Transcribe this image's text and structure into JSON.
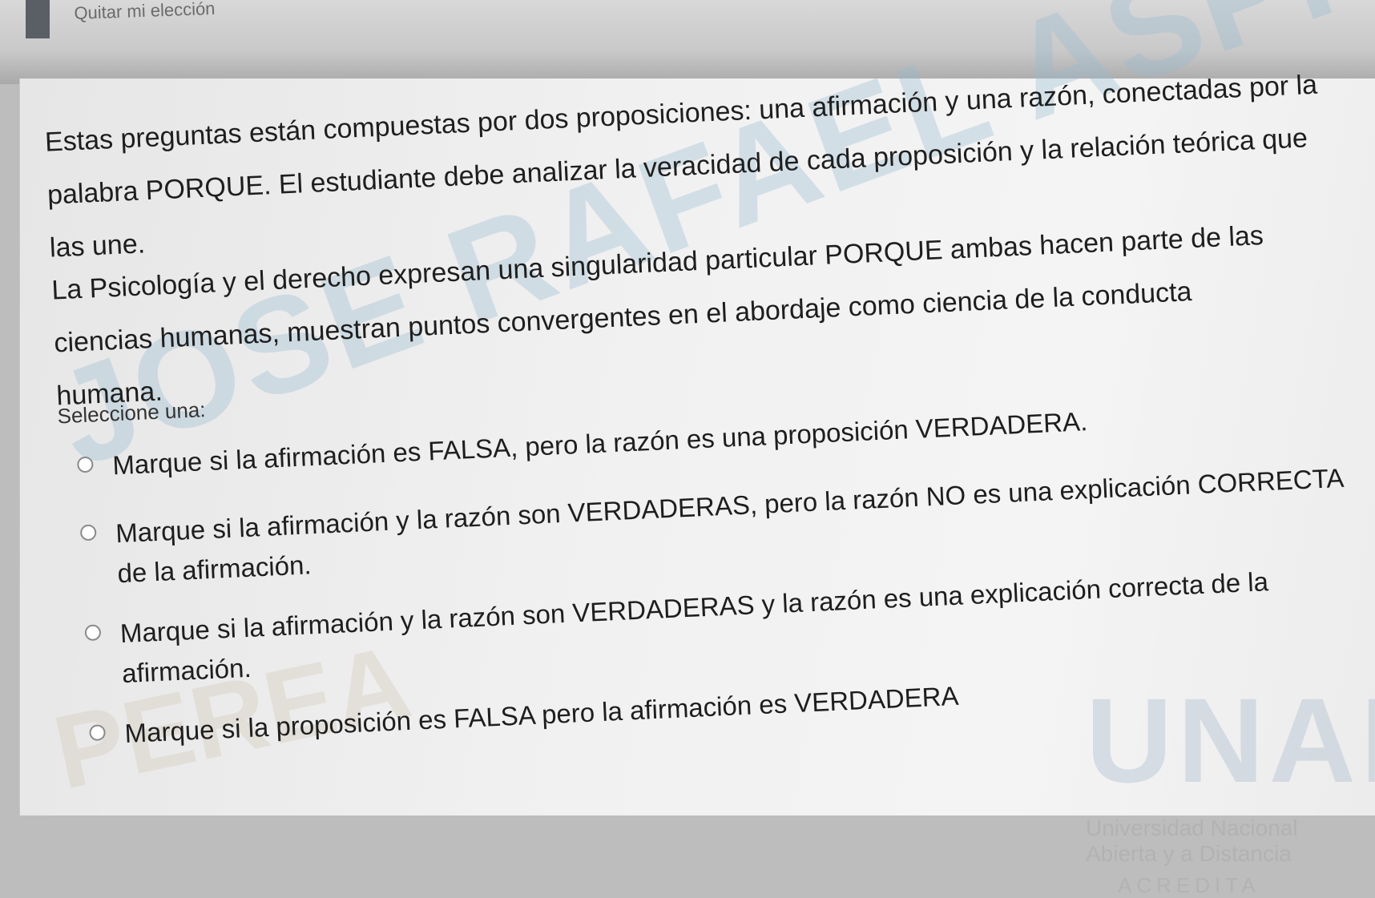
{
  "header": {
    "clear_choice_label": "Quitar mi elección"
  },
  "question": {
    "intro": "Estas preguntas están compuestas por dos proposiciones: una afirmación y una razón, conectadas por la palabra PORQUE. El estudiante debe analizar la veracidad de cada proposición y la relación teórica que las une.",
    "statement": "La Psicología y el derecho expresan una singularidad particular PORQUE ambas hacen parte de las ciencias humanas, muestran puntos convergentes en el abordaje como ciencia de la conducta humana.",
    "select_label": "Seleccione una:",
    "options": [
      {
        "label": "Marque si la afirmación es FALSA, pero la razón es una proposición VERDADERA."
      },
      {
        "label": "Marque si la afirmación y la razón son VERDADERAS, pero la razón NO es una explicación CORRECTA de la afirmación."
      },
      {
        "label": "Marque si la afirmación y la razón son VERDADERAS y la razón es una explicación correcta de la afirmación."
      },
      {
        "label": "Marque si la proposición es FALSA pero la afirmación es VERDADERA"
      }
    ]
  },
  "watermark": {
    "name": "JOSE RAFAEL ASPRILLA",
    "surname": "PEREA"
  },
  "logo": {
    "acronym": "UNAD",
    "line1": "Universidad Nacional",
    "line2": "Abierta y a Distancia",
    "line3": "ACREDITA"
  }
}
